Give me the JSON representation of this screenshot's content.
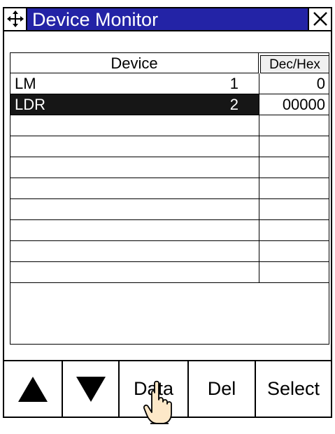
{
  "window": {
    "title": "Device Monitor",
    "title_bar_color": "#2323a6"
  },
  "icons": {
    "move": "move-arrows-icon",
    "close": "close-x-icon",
    "up": "triangle-up-icon",
    "down": "triangle-down-icon",
    "pointer": "hand-pointer-icon"
  },
  "table": {
    "columns": [
      "Device",
      "Dec/Hex"
    ],
    "rows": [
      {
        "name": "LM",
        "number": "1",
        "value": "0",
        "selected": false
      },
      {
        "name": "LDR",
        "number": "2",
        "value": "00000",
        "selected": true
      },
      {
        "name": "",
        "number": "",
        "value": ""
      },
      {
        "name": "",
        "number": "",
        "value": ""
      },
      {
        "name": "",
        "number": "",
        "value": ""
      },
      {
        "name": "",
        "number": "",
        "value": ""
      },
      {
        "name": "",
        "number": "",
        "value": ""
      },
      {
        "name": "",
        "number": "",
        "value": ""
      },
      {
        "name": "",
        "number": "",
        "value": ""
      },
      {
        "name": "",
        "number": "",
        "value": ""
      }
    ]
  },
  "buttons": {
    "data": "Data",
    "del": "Del",
    "select": "Select"
  }
}
